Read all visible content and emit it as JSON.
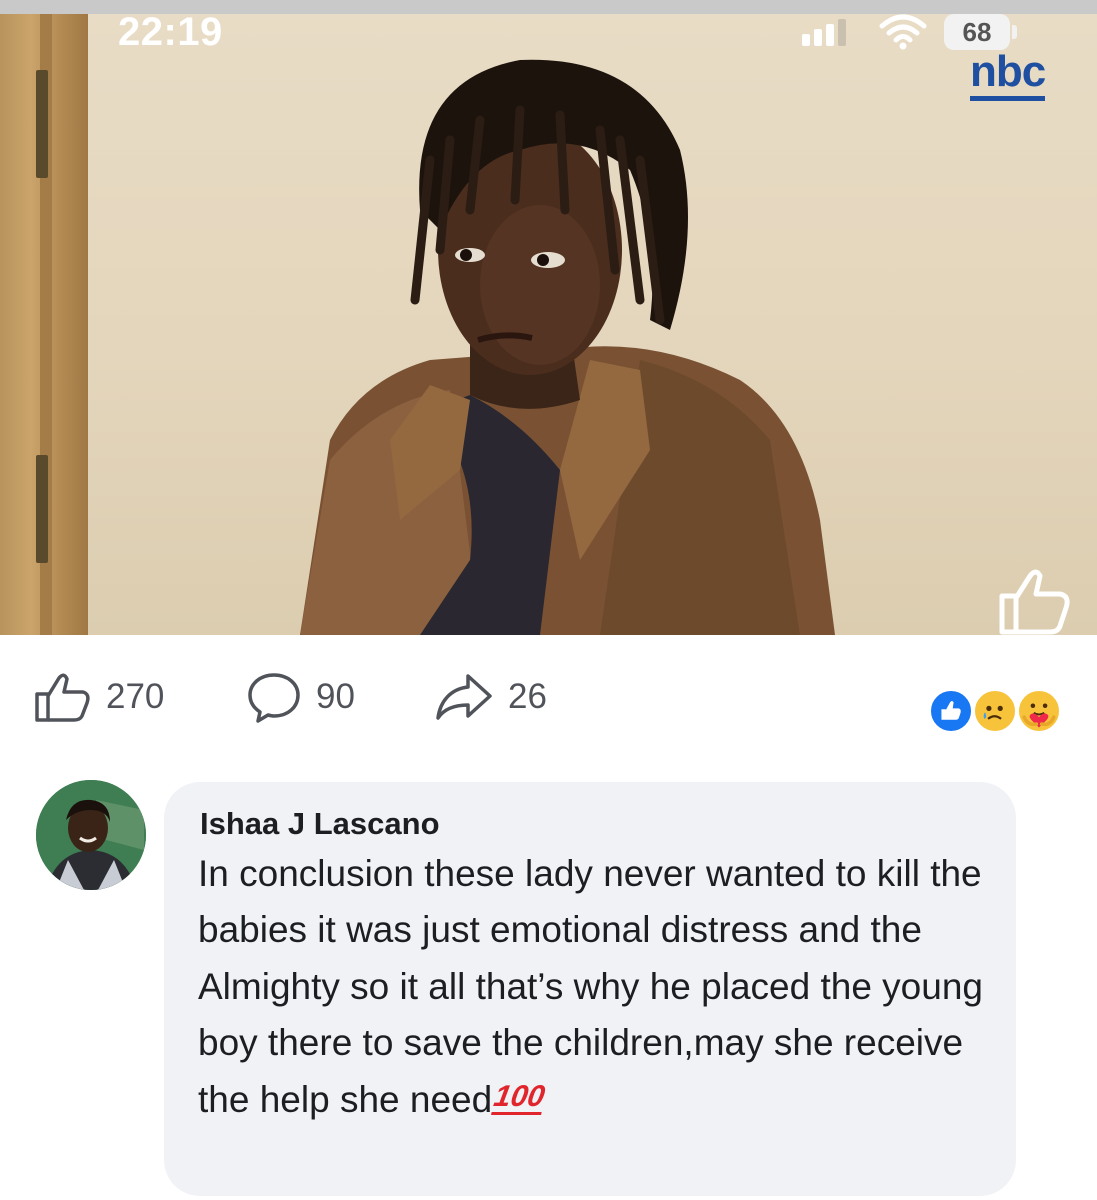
{
  "status_bar": {
    "time": "22:19",
    "battery": "68"
  },
  "video": {
    "channel_logo": "nbc",
    "overlay_icon": "thumbs-up-icon"
  },
  "engagement": {
    "likes": "270",
    "comments": "90",
    "shares": "26",
    "reactions": [
      "like-reaction-icon",
      "sad-reaction-icon",
      "care-reaction-icon"
    ]
  },
  "comment": {
    "author": "Ishaa J Lascano",
    "text": "In conclusion these lady never wanted to kill the babies it was just emotional distress and the Almighty so it all that’s why he placed the young boy there to save the children,may she receive the help she need",
    "emoji": "100",
    "emoji_name": "hundred-points-icon"
  },
  "colors": {
    "nbc_blue": "#1f4fa0",
    "like_blue": "#1877f2",
    "bubble_gray": "#f0f2f5",
    "hundred_red": "#e0252c"
  }
}
